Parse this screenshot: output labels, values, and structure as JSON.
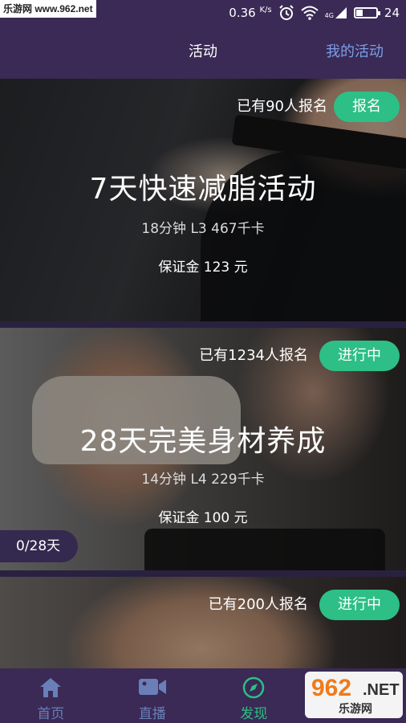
{
  "status_bar": {
    "watermark": "乐游网 www.962.net",
    "speed": "0.36",
    "speed_unit": "K/s",
    "network": "4G",
    "battery": "24"
  },
  "header": {
    "title": "活动",
    "my_activities": "我的活动"
  },
  "activities": [
    {
      "signup_count": "已有90人报名",
      "action": "报名",
      "title": "7天快速减脂活动",
      "meta": "18分钟  L3  467千卡",
      "deposit": "保证金 123 元"
    },
    {
      "signup_count": "已有1234人报名",
      "action": "进行中",
      "title": "28天完美身材养成",
      "meta": "14分钟  L4  229千卡",
      "deposit": "保证金 100 元",
      "progress": "0/28天"
    },
    {
      "signup_count": "已有200人报名",
      "action": "进行中"
    }
  ],
  "nav": {
    "items": [
      {
        "label": "首页",
        "icon": "home-icon"
      },
      {
        "label": "直播",
        "icon": "video-camera-icon"
      },
      {
        "label": "发现",
        "icon": "compass-icon"
      },
      {
        "label": "",
        "icon": "profile-icon"
      }
    ],
    "active_index": 2
  },
  "watermark_bottom": {
    "number": "962",
    "domain": ".NET",
    "site": "乐游网"
  },
  "colors": {
    "header_bg": "#3a2a55",
    "accent_green": "#2dbf85",
    "link_blue": "#7c9ee6",
    "nav_inactive": "#6a7fb8"
  }
}
